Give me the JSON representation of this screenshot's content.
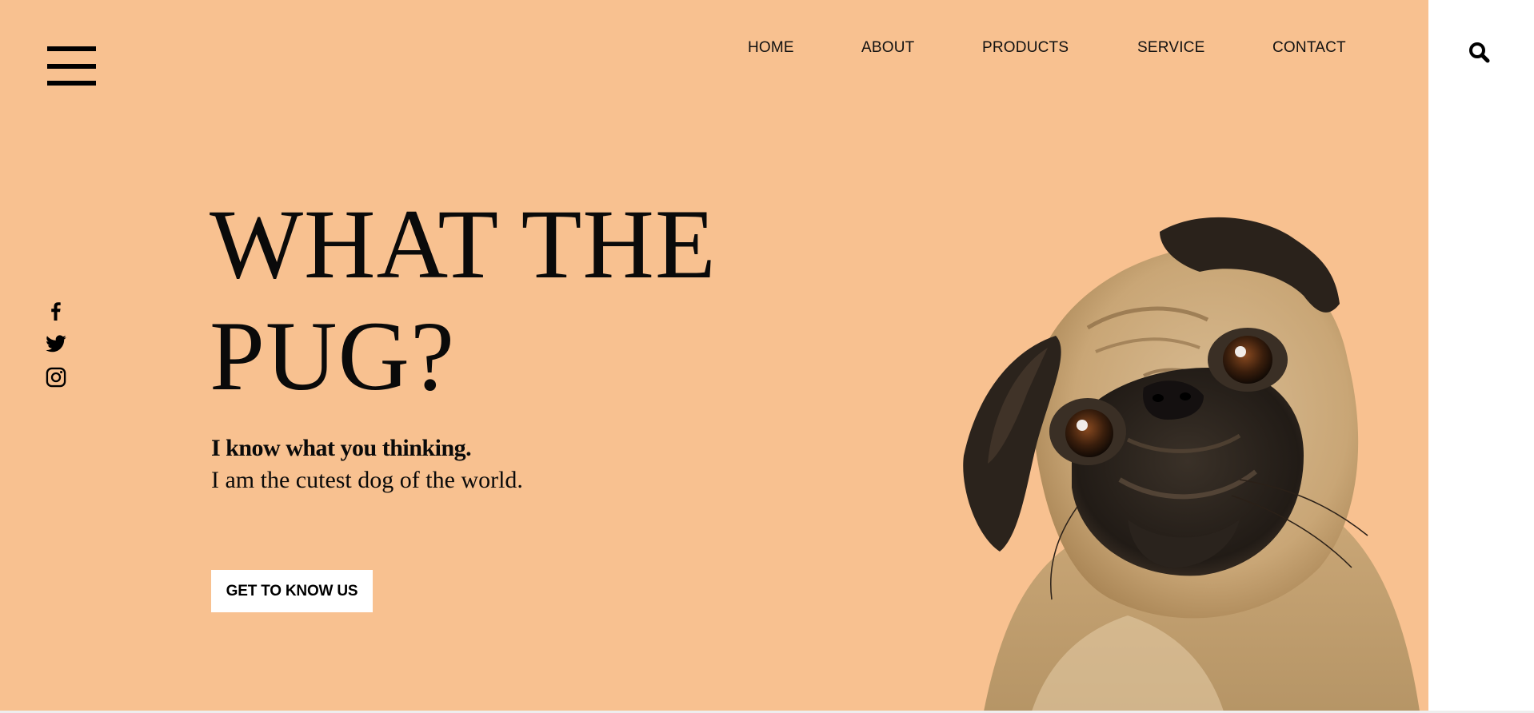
{
  "header": {
    "menu_icon": "hamburger-menu-icon",
    "search_icon": "search-icon"
  },
  "nav": {
    "items": [
      {
        "label": "HOME"
      },
      {
        "label": "ABOUT"
      },
      {
        "label": "PRODUCTS"
      },
      {
        "label": "SERVICE"
      },
      {
        "label": "CONTACT"
      }
    ]
  },
  "social": {
    "icons": [
      "facebook-icon",
      "twitter-icon",
      "instagram-icon"
    ]
  },
  "hero": {
    "headline_line1": "WHAT THE",
    "headline_line2": "PUG?",
    "tagline_bold": "I know what you thinking.",
    "tagline_regular": "I am the cutest dog of the world.",
    "cta_label": "GET TO KNOW US",
    "image": "pug-photo"
  },
  "colors": {
    "hero_background": "#f8c190",
    "page_background": "#ffffff",
    "text": "#0a0a0a",
    "button_background": "#ffffff"
  }
}
